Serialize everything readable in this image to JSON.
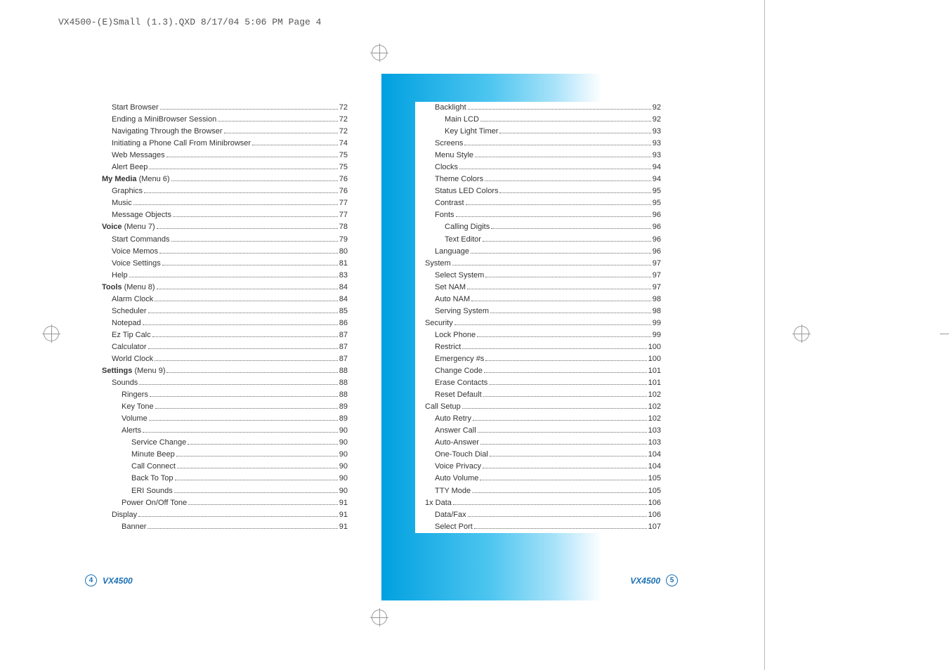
{
  "header": "VX4500-(E)Small (1.3).QXD  8/17/04  5:06 PM  Page 4",
  "model": "VX4500",
  "pages": {
    "left": "4",
    "right": "5"
  },
  "left_toc": [
    {
      "label": "Start Browser",
      "indent": 1,
      "page": "72"
    },
    {
      "label": "Ending a MiniBrowser Session",
      "indent": 1,
      "page": "72"
    },
    {
      "label": "Navigating Through the Browser",
      "indent": 1,
      "page": "72"
    },
    {
      "label": "Initiating a Phone Call From Minibrowser",
      "indent": 1,
      "page": "74"
    },
    {
      "label": "Web Messages",
      "indent": 1,
      "page": "75"
    },
    {
      "label": "Alert Beep",
      "indent": 1,
      "page": "75"
    },
    {
      "label_html": "<b>My Media</b> (Menu 6)",
      "indent": 0,
      "page": "76"
    },
    {
      "label": "Graphics",
      "indent": 1,
      "page": "76"
    },
    {
      "label": "Music",
      "indent": 1,
      "page": "77"
    },
    {
      "label": "Message Objects",
      "indent": 1,
      "page": "77"
    },
    {
      "label_html": "<b>Voice</b> (Menu 7)",
      "indent": 0,
      "page": "78"
    },
    {
      "label": "Start Commands",
      "indent": 1,
      "page": "79"
    },
    {
      "label": "Voice Memos",
      "indent": 1,
      "page": "80"
    },
    {
      "label": "Voice Settings",
      "indent": 1,
      "page": "81"
    },
    {
      "label": "Help",
      "indent": 1,
      "page": "83"
    },
    {
      "label_html": "<b>Tools</b> (Menu 8)",
      "indent": 0,
      "page": "84"
    },
    {
      "label": "Alarm Clock",
      "indent": 1,
      "page": "84"
    },
    {
      "label": "Scheduler",
      "indent": 1,
      "page": "85"
    },
    {
      "label": "Notepad",
      "indent": 1,
      "page": "86"
    },
    {
      "label": "Ez Tip Calc",
      "indent": 1,
      "page": "87"
    },
    {
      "label": "Calculator",
      "indent": 1,
      "page": "87"
    },
    {
      "label": "World Clock",
      "indent": 1,
      "page": "87"
    },
    {
      "label_html": "<b>Settings</b> (Menu 9)",
      "indent": 0,
      "page": "88"
    },
    {
      "label": "Sounds",
      "indent": 1,
      "page": "88"
    },
    {
      "label": "Ringers",
      "indent": 2,
      "page": "88"
    },
    {
      "label": "Key Tone",
      "indent": 2,
      "page": "89"
    },
    {
      "label": "Volume",
      "indent": 2,
      "page": "89"
    },
    {
      "label": "Alerts",
      "indent": 2,
      "page": "90"
    },
    {
      "label": "Service Change",
      "indent": 3,
      "page": "90"
    },
    {
      "label": "Minute Beep",
      "indent": 3,
      "page": "90"
    },
    {
      "label": "Call Connect",
      "indent": 3,
      "page": "90"
    },
    {
      "label": "Back To Top",
      "indent": 3,
      "page": "90"
    },
    {
      "label": "ERI Sounds",
      "indent": 3,
      "page": "90"
    },
    {
      "label": "Power On/Off Tone",
      "indent": 2,
      "page": "91"
    },
    {
      "label": "Display",
      "indent": 1,
      "page": "91"
    },
    {
      "label": "Banner",
      "indent": 2,
      "page": "91"
    }
  ],
  "right_toc": [
    {
      "label": "Backlight",
      "indent": 2,
      "page": "92"
    },
    {
      "label": "Main LCD",
      "indent": 3,
      "page": "92"
    },
    {
      "label": "Key Light Timer",
      "indent": 3,
      "page": "93"
    },
    {
      "label": "Screens",
      "indent": 2,
      "page": "93"
    },
    {
      "label": "Menu Style",
      "indent": 2,
      "page": "93"
    },
    {
      "label": "Clocks",
      "indent": 2,
      "page": "94"
    },
    {
      "label": "Theme Colors",
      "indent": 2,
      "page": "94"
    },
    {
      "label": "Status LED Colors",
      "indent": 2,
      "page": "95"
    },
    {
      "label": "Contrast",
      "indent": 2,
      "page": "95"
    },
    {
      "label": "Fonts",
      "indent": 2,
      "page": "96"
    },
    {
      "label": "Calling Digits",
      "indent": 3,
      "page": "96"
    },
    {
      "label": "Text Editor",
      "indent": 3,
      "page": "96"
    },
    {
      "label": "Language",
      "indent": 2,
      "page": "96"
    },
    {
      "label": "System",
      "indent": 1,
      "page": "97"
    },
    {
      "label": "Select System",
      "indent": 2,
      "page": "97"
    },
    {
      "label": "Set NAM",
      "indent": 2,
      "page": "97"
    },
    {
      "label": "Auto NAM",
      "indent": 2,
      "page": "98"
    },
    {
      "label": "Serving System",
      "indent": 2,
      "page": "98"
    },
    {
      "label": "Security",
      "indent": 1,
      "page": "99"
    },
    {
      "label": "Lock Phone",
      "indent": 2,
      "page": "99"
    },
    {
      "label": "Restrict",
      "indent": 2,
      "page": "100"
    },
    {
      "label": "Emergency #s",
      "indent": 2,
      "page": "100"
    },
    {
      "label": "Change Code",
      "indent": 2,
      "page": "101"
    },
    {
      "label": "Erase Contacts",
      "indent": 2,
      "page": "101"
    },
    {
      "label": "Reset Default",
      "indent": 2,
      "page": "102"
    },
    {
      "label": "Call Setup",
      "indent": 1,
      "page": "102"
    },
    {
      "label": "Auto Retry",
      "indent": 2,
      "page": "102"
    },
    {
      "label": "Answer Call",
      "indent": 2,
      "page": "103"
    },
    {
      "label": "Auto-Answer",
      "indent": 2,
      "page": "103"
    },
    {
      "label": "One-Touch Dial",
      "indent": 2,
      "page": "104"
    },
    {
      "label": "Voice Privacy",
      "indent": 2,
      "page": "104"
    },
    {
      "label": "Auto Volume",
      "indent": 2,
      "page": "105"
    },
    {
      "label": "TTY Mode",
      "indent": 2,
      "page": "105"
    },
    {
      "label": "1x Data",
      "indent": 1,
      "page": "106"
    },
    {
      "label": "Data/Fax",
      "indent": 2,
      "page": "106"
    },
    {
      "label": "Select Port",
      "indent": 2,
      "page": "107"
    }
  ]
}
